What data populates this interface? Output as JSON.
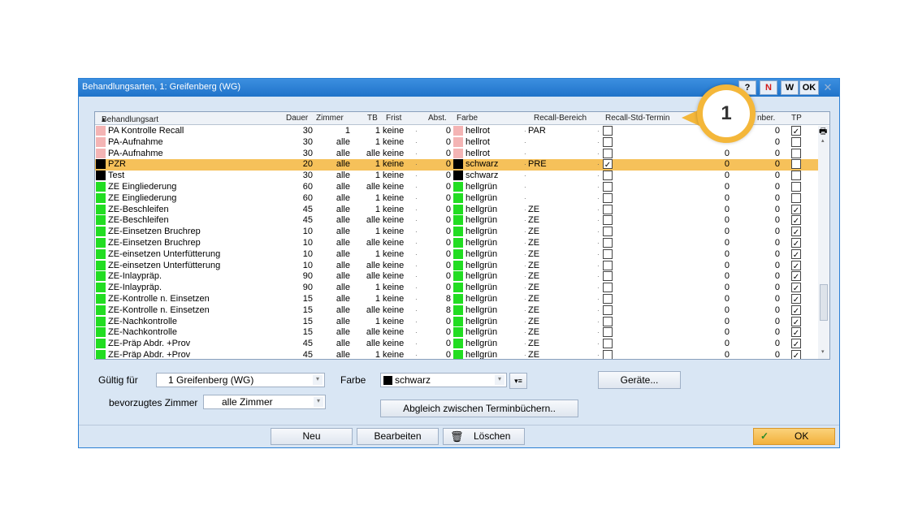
{
  "window": {
    "title": "Behandlungsarten, 1: Greifenberg (WG)",
    "buttons": {
      "help": "?",
      "n": "N",
      "w": "W",
      "ok": "OK"
    }
  },
  "grid": {
    "columns": [
      "Behandlungsart",
      "Dauer",
      "Zimmer",
      "TB",
      "Frist",
      "Abst.",
      "Farbe",
      "Recall-Bereich",
      "Recall-Std-Termin",
      "nber.",
      "TP"
    ],
    "rows": [
      {
        "name": "PA Kontrolle Recall",
        "dauer": "30",
        "zimmer": "1",
        "tb": "1",
        "frist": "keine",
        "abst": "0",
        "color": "#f4b4b4",
        "farbe": "hellrot",
        "recall": "PAR",
        "std": false,
        "a": "",
        "b": "0",
        "tp": true,
        "sel": false
      },
      {
        "name": "PA-Aufnahme",
        "dauer": "30",
        "zimmer": "alle",
        "tb": "1",
        "frist": "keine",
        "abst": "0",
        "color": "#f4b4b4",
        "farbe": "hellrot",
        "recall": "",
        "std": false,
        "a": "",
        "b": "0",
        "tp": false,
        "sel": false
      },
      {
        "name": "PA-Aufnahme",
        "dauer": "30",
        "zimmer": "alle",
        "tb": "alle",
        "frist": "keine",
        "abst": "0",
        "color": "#f4b4b4",
        "farbe": "hellrot",
        "recall": "",
        "std": false,
        "a": "0",
        "b": "0",
        "tp": false,
        "sel": false
      },
      {
        "name": "PZR",
        "dauer": "20",
        "zimmer": "alle",
        "tb": "1",
        "frist": "keine",
        "abst": "0",
        "color": "#000000",
        "farbe": "schwarz",
        "recall": "PRE",
        "std": true,
        "a": "0",
        "b": "0",
        "tp": false,
        "sel": true
      },
      {
        "name": "Test",
        "dauer": "30",
        "zimmer": "alle",
        "tb": "1",
        "frist": "keine",
        "abst": "0",
        "color": "#000000",
        "farbe": "schwarz",
        "recall": "",
        "std": false,
        "a": "0",
        "b": "0",
        "tp": false,
        "sel": false
      },
      {
        "name": "ZE Eingliederung",
        "dauer": "60",
        "zimmer": "alle",
        "tb": "alle",
        "frist": "keine",
        "abst": "0",
        "color": "#22dd22",
        "farbe": "hellgrün",
        "recall": "",
        "std": false,
        "a": "0",
        "b": "0",
        "tp": false,
        "sel": false
      },
      {
        "name": "ZE Eingliederung",
        "dauer": "60",
        "zimmer": "alle",
        "tb": "1",
        "frist": "keine",
        "abst": "0",
        "color": "#22dd22",
        "farbe": "hellgrün",
        "recall": "",
        "std": false,
        "a": "0",
        "b": "0",
        "tp": false,
        "sel": false
      },
      {
        "name": "ZE-Beschleifen",
        "dauer": "45",
        "zimmer": "alle",
        "tb": "1",
        "frist": "keine",
        "abst": "0",
        "color": "#22dd22",
        "farbe": "hellgrün",
        "recall": "ZE",
        "std": false,
        "a": "0",
        "b": "0",
        "tp": true,
        "sel": false
      },
      {
        "name": "ZE-Beschleifen",
        "dauer": "45",
        "zimmer": "alle",
        "tb": "alle",
        "frist": "keine",
        "abst": "0",
        "color": "#22dd22",
        "farbe": "hellgrün",
        "recall": "ZE",
        "std": false,
        "a": "0",
        "b": "0",
        "tp": true,
        "sel": false
      },
      {
        "name": "ZE-Einsetzen Bruchrep",
        "dauer": "10",
        "zimmer": "alle",
        "tb": "1",
        "frist": "keine",
        "abst": "0",
        "color": "#22dd22",
        "farbe": "hellgrün",
        "recall": "ZE",
        "std": false,
        "a": "0",
        "b": "0",
        "tp": true,
        "sel": false
      },
      {
        "name": "ZE-Einsetzen Bruchrep",
        "dauer": "10",
        "zimmer": "alle",
        "tb": "alle",
        "frist": "keine",
        "abst": "0",
        "color": "#22dd22",
        "farbe": "hellgrün",
        "recall": "ZE",
        "std": false,
        "a": "0",
        "b": "0",
        "tp": true,
        "sel": false
      },
      {
        "name": "ZE-einsetzen Unterfütterung",
        "dauer": "10",
        "zimmer": "alle",
        "tb": "1",
        "frist": "keine",
        "abst": "0",
        "color": "#22dd22",
        "farbe": "hellgrün",
        "recall": "ZE",
        "std": false,
        "a": "0",
        "b": "0",
        "tp": true,
        "sel": false
      },
      {
        "name": "ZE-einsetzen Unterfütterung",
        "dauer": "10",
        "zimmer": "alle",
        "tb": "alle",
        "frist": "keine",
        "abst": "0",
        "color": "#22dd22",
        "farbe": "hellgrün",
        "recall": "ZE",
        "std": false,
        "a": "0",
        "b": "0",
        "tp": true,
        "sel": false
      },
      {
        "name": "ZE-Inlaypräp.",
        "dauer": "90",
        "zimmer": "alle",
        "tb": "alle",
        "frist": "keine",
        "abst": "0",
        "color": "#22dd22",
        "farbe": "hellgrün",
        "recall": "ZE",
        "std": false,
        "a": "0",
        "b": "0",
        "tp": true,
        "sel": false
      },
      {
        "name": "ZE-Inlaypräp.",
        "dauer": "90",
        "zimmer": "alle",
        "tb": "1",
        "frist": "keine",
        "abst": "0",
        "color": "#22dd22",
        "farbe": "hellgrün",
        "recall": "ZE",
        "std": false,
        "a": "0",
        "b": "0",
        "tp": true,
        "sel": false
      },
      {
        "name": "ZE-Kontrolle n. Einsetzen",
        "dauer": "15",
        "zimmer": "alle",
        "tb": "1",
        "frist": "keine",
        "abst": "8",
        "color": "#22dd22",
        "farbe": "hellgrün",
        "recall": "ZE",
        "std": false,
        "a": "0",
        "b": "0",
        "tp": true,
        "sel": false
      },
      {
        "name": "ZE-Kontrolle n. Einsetzen",
        "dauer": "15",
        "zimmer": "alle",
        "tb": "alle",
        "frist": "keine",
        "abst": "8",
        "color": "#22dd22",
        "farbe": "hellgrün",
        "recall": "ZE",
        "std": false,
        "a": "0",
        "b": "0",
        "tp": true,
        "sel": false
      },
      {
        "name": "ZE-Nachkontrolle",
        "dauer": "15",
        "zimmer": "alle",
        "tb": "1",
        "frist": "keine",
        "abst": "0",
        "color": "#22dd22",
        "farbe": "hellgrün",
        "recall": "ZE",
        "std": false,
        "a": "0",
        "b": "0",
        "tp": true,
        "sel": false
      },
      {
        "name": "ZE-Nachkontrolle",
        "dauer": "15",
        "zimmer": "alle",
        "tb": "alle",
        "frist": "keine",
        "abst": "0",
        "color": "#22dd22",
        "farbe": "hellgrün",
        "recall": "ZE",
        "std": false,
        "a": "0",
        "b": "0",
        "tp": true,
        "sel": false
      },
      {
        "name": "ZE-Präp Abdr. +Prov",
        "dauer": "45",
        "zimmer": "alle",
        "tb": "alle",
        "frist": "keine",
        "abst": "0",
        "color": "#22dd22",
        "farbe": "hellgrün",
        "recall": "ZE",
        "std": false,
        "a": "0",
        "b": "0",
        "tp": true,
        "sel": false
      },
      {
        "name": "ZE-Präp Abdr. +Prov",
        "dauer": "45",
        "zimmer": "alle",
        "tb": "1",
        "frist": "keine",
        "abst": "0",
        "color": "#22dd22",
        "farbe": "hellgrün",
        "recall": "ZE",
        "std": false,
        "a": "0",
        "b": "0",
        "tp": true,
        "sel": false
      }
    ]
  },
  "form": {
    "gueltig_label": "Gültig für",
    "gueltig_value": "1 Greifenberg (WG)",
    "farbe_label": "Farbe",
    "farbe_value": "schwarz",
    "farbe_color": "#000000",
    "zimmer_label": "bevorzugtes Zimmer",
    "zimmer_value": "alle Zimmer",
    "geraete_label": "Geräte...",
    "abgleich_label": "Abgleich zwischen Terminbüchern.."
  },
  "footer": {
    "neu": "Neu",
    "bearbeiten": "Bearbeiten",
    "loeschen": "Löschen",
    "ok": "OK"
  },
  "callout": {
    "number": "1"
  },
  "colors": {
    "titlebar": "#1f73c9",
    "selection": "#f6c15a",
    "accent": "#f4b73a"
  }
}
